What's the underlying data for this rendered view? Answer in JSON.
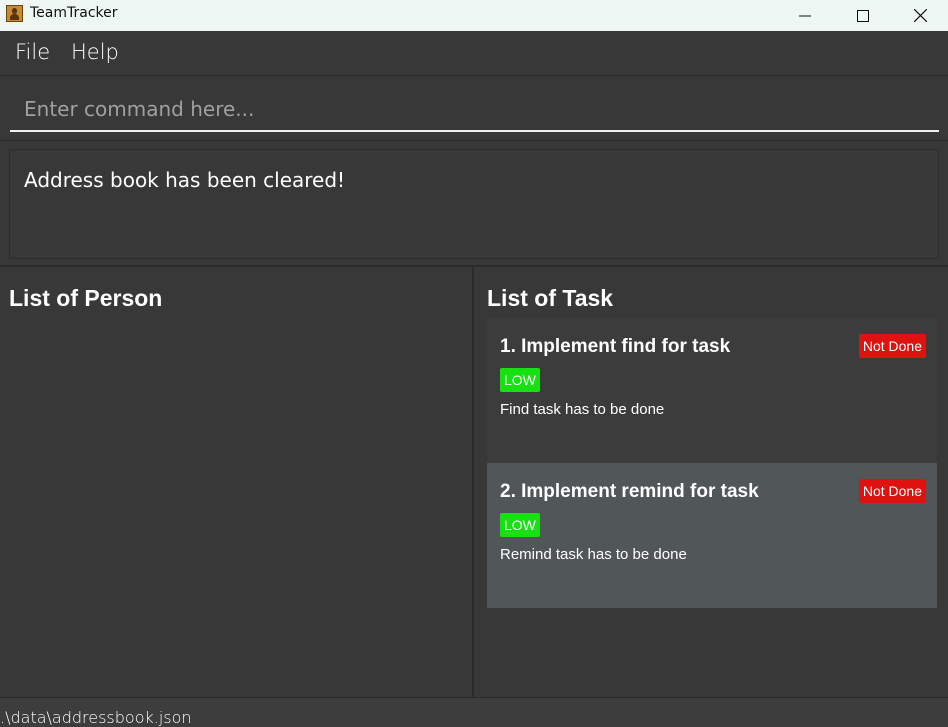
{
  "window": {
    "title": "TeamTracker",
    "icons": {
      "app": "app-contact-icon",
      "minimize": "minimize-icon",
      "maximize": "maximize-icon",
      "close": "close-icon"
    }
  },
  "menu": {
    "file": "File",
    "help": "Help"
  },
  "command": {
    "placeholder": "Enter command here...",
    "value": ""
  },
  "result": {
    "message": "Address book has been cleared!"
  },
  "person_panel": {
    "title": "List of Person",
    "items": []
  },
  "task_panel": {
    "title": "List of Task",
    "tasks": [
      {
        "name": "1. Implement find for task",
        "status": "Not Done",
        "priority": "LOW",
        "description": "Find task has to be done"
      },
      {
        "name": "2. Implement remind for task",
        "status": "Not Done",
        "priority": "LOW",
        "description": "Remind task has to be done"
      }
    ]
  },
  "status_bar": {
    "path": ".\\data\\addressbook.json"
  },
  "colors": {
    "status_not_done": "#e0120f",
    "priority_low": "#17e013",
    "background": "#383838"
  }
}
